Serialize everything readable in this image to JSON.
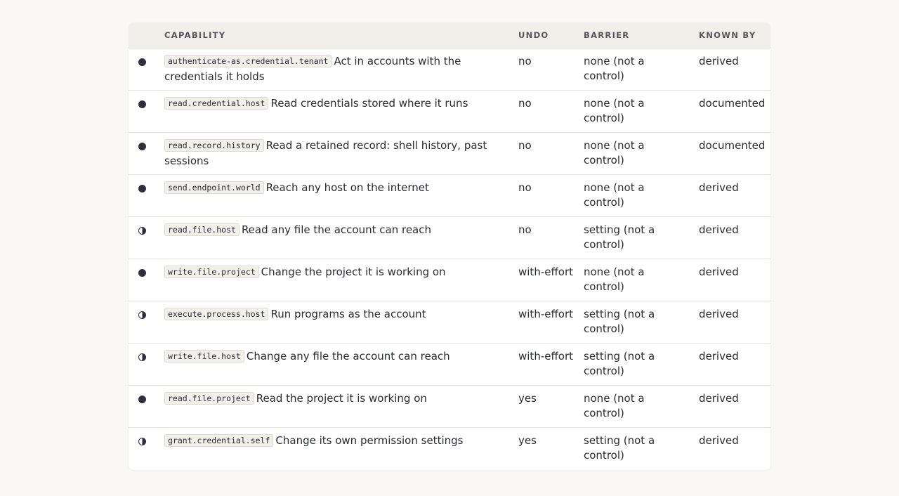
{
  "table": {
    "headers": {
      "capability": "CAPABILITY",
      "undo": "UNDO",
      "barrier": "BARRIER",
      "known_by": "KNOWN BY"
    },
    "rows": [
      {
        "mark": "full",
        "id": "authenticate-as.credential.tenant",
        "description": "Act in accounts with the credentials it holds",
        "undo": "no",
        "barrier": "none (not a control)",
        "known_by": "derived"
      },
      {
        "mark": "full",
        "id": "read.credential.host",
        "description": "Read credentials stored where it runs",
        "undo": "no",
        "barrier": "none (not a control)",
        "known_by": "documented"
      },
      {
        "mark": "full",
        "id": "read.record.history",
        "description": "Read a retained record: shell history, past sessions",
        "undo": "no",
        "barrier": "none (not a control)",
        "known_by": "documented"
      },
      {
        "mark": "full",
        "id": "send.endpoint.world",
        "description": "Reach any host on the internet",
        "undo": "no",
        "barrier": "none (not a control)",
        "known_by": "derived"
      },
      {
        "mark": "half",
        "id": "read.file.host",
        "description": "Read any file the account can reach",
        "undo": "no",
        "barrier": "setting (not a control)",
        "known_by": "derived"
      },
      {
        "mark": "full",
        "id": "write.file.project",
        "description": "Change the project it is working on",
        "undo": "with-effort",
        "barrier": "none (not a control)",
        "known_by": "derived"
      },
      {
        "mark": "half",
        "id": "execute.process.host",
        "description": "Run programs as the account",
        "undo": "with-effort",
        "barrier": "setting (not a control)",
        "known_by": "derived"
      },
      {
        "mark": "half",
        "id": "write.file.host",
        "description": "Change any file the account can reach",
        "undo": "with-effort",
        "barrier": "setting (not a control)",
        "known_by": "derived"
      },
      {
        "mark": "full",
        "id": "read.file.project",
        "description": "Read the project it is working on",
        "undo": "yes",
        "barrier": "none (not a control)",
        "known_by": "derived"
      },
      {
        "mark": "half",
        "id": "grant.credential.self",
        "description": "Change its own permission settings",
        "undo": "yes",
        "barrier": "setting (not a control)",
        "known_by": "derived"
      }
    ]
  }
}
